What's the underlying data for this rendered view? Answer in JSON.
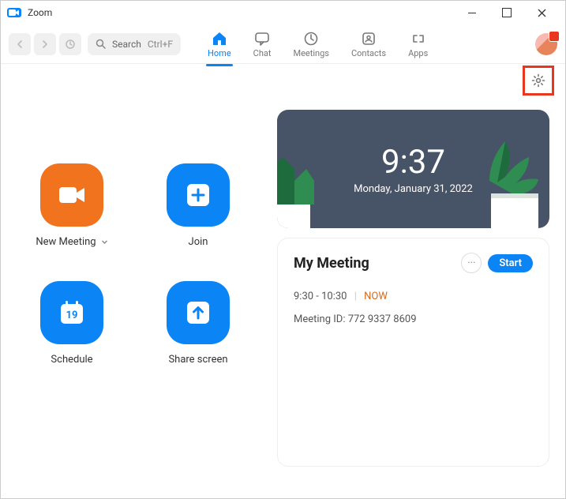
{
  "window": {
    "title": "Zoom"
  },
  "toolbar": {
    "search_label": "Search",
    "search_shortcut": "Ctrl+F",
    "tabs": {
      "home": "Home",
      "chat": "Chat",
      "meetings": "Meetings",
      "contacts": "Contacts",
      "apps": "Apps"
    }
  },
  "tiles": {
    "new_meeting": "New Meeting",
    "join": "Join",
    "schedule": "Schedule",
    "schedule_day": "19",
    "share_screen": "Share screen"
  },
  "clock": {
    "time": "9:37",
    "date": "Monday, January 31, 2022"
  },
  "meeting": {
    "title": "My Meeting",
    "time_range": "9:30 - 10:30",
    "now_label": "NOW",
    "id_label": "Meeting ID: 772 9337 8609",
    "start_label": "Start",
    "more_label": "···"
  }
}
